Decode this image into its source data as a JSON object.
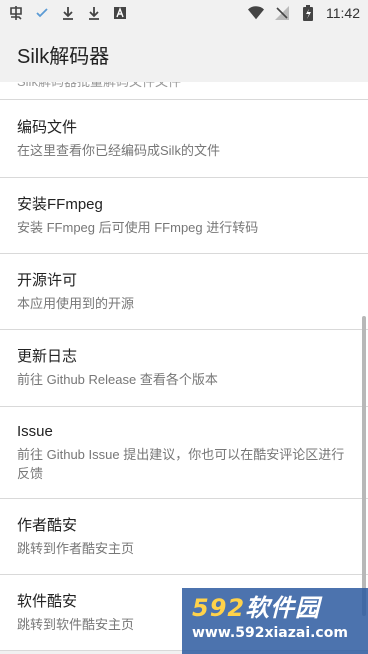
{
  "status_bar": {
    "time": "11:42",
    "icons_left": [
      "app-notification-icon",
      "check-icon",
      "download-icon",
      "download-icon",
      "font-icon"
    ],
    "icons_right": [
      "wifi-icon",
      "no-signal-icon",
      "battery-charging-icon"
    ]
  },
  "app": {
    "title": "Silk解码器"
  },
  "list": {
    "items": [
      {
        "title": "",
        "subtitle": "Silk解码器批量解码文件文件"
      },
      {
        "title": "编码文件",
        "subtitle": "在这里查看你已经编码成Silk的文件"
      },
      {
        "title": "安装FFmpeg",
        "subtitle": "安装 FFmpeg 后可使用 FFmpeg 进行转码"
      },
      {
        "title": "开源许可",
        "subtitle": "本应用使用到的开源"
      },
      {
        "title": "更新日志",
        "subtitle": "前往 Github Release 查看各个版本"
      },
      {
        "title": "Issue",
        "subtitle": "前往 Github Issue 提出建议，你也可以在酷安评论区进行反馈"
      },
      {
        "title": "作者酷安",
        "subtitle": "跳转到作者酷安主页"
      },
      {
        "title": "软件酷安",
        "subtitle": "跳转到软件酷安主页"
      }
    ]
  },
  "watermark": {
    "brand_number": "592",
    "brand_text": "软件园",
    "url": "www.592xiazai.com"
  },
  "colors": {
    "background": "#f1f1f1",
    "card": "#ffffff",
    "watermark_bg": "#2d5aa0",
    "watermark_accent": "#ffd24a"
  }
}
